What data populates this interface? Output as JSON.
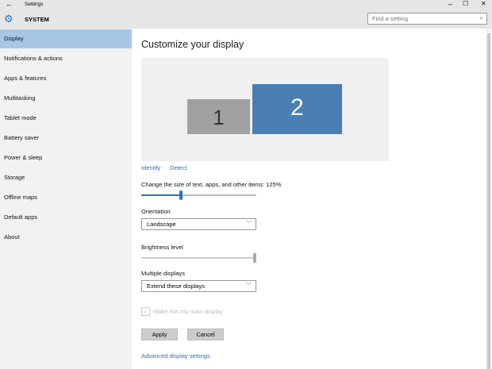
{
  "window": {
    "title": "Settings",
    "back_icon": "arrow-left-icon"
  },
  "header": {
    "section": "SYSTEM",
    "search_placeholder": "Find a setting"
  },
  "sidebar": {
    "items": [
      {
        "label": "Display",
        "selected": true
      },
      {
        "label": "Notifications & actions"
      },
      {
        "label": "Apps & features"
      },
      {
        "label": "Multitasking"
      },
      {
        "label": "Tablet mode"
      },
      {
        "label": "Battery saver"
      },
      {
        "label": "Power & sleep"
      },
      {
        "label": "Storage"
      },
      {
        "label": "Offline maps"
      },
      {
        "label": "Default apps"
      },
      {
        "label": "About"
      }
    ]
  },
  "main": {
    "title": "Customize your display",
    "monitors": [
      {
        "label": "1"
      },
      {
        "label": "2",
        "selected": true
      }
    ],
    "identify": "Identify",
    "detect": "Detect",
    "scale_label": "Change the size of text, apps, and other items: 125%",
    "scale_fraction": 0.34,
    "orientation_label": "Orientation",
    "orientation_value": "Landscape",
    "brightness_label": "Brightness level",
    "brightness_fraction": 1.0,
    "multiple_label": "Multiple displays",
    "multiple_value": "Extend these displays",
    "main_display_label": "Make this my main display",
    "apply": "Apply",
    "cancel": "Cancel",
    "advanced": "Advanced display settings"
  },
  "colors": {
    "accent": "#2a6fc0",
    "selected_nav": "#a7c7e7",
    "monitor_active": "#4a7eb5",
    "monitor_inactive": "#a0a0a0"
  }
}
